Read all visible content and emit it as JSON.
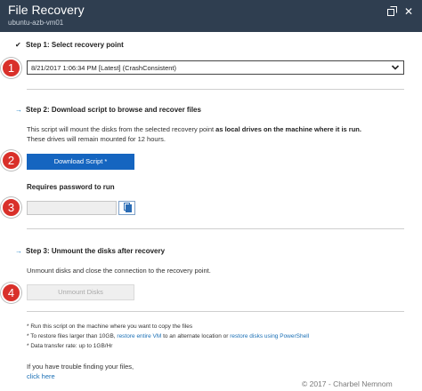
{
  "window": {
    "title": "File Recovery",
    "subtitle": "ubuntu-azb-vm01",
    "popout_icon": "popout-icon",
    "close_glyph": "✕"
  },
  "step1": {
    "mark": "✔",
    "heading": "Step 1: Select recovery point",
    "selected_point": "8/21/2017 1:06:34 PM [Latest] (CrashConsistent)"
  },
  "step2": {
    "mark": "→",
    "heading": "Step 2: Download script to browse and recover files",
    "desc_part1": "This script will mount the disks from the selected recovery point ",
    "desc_bold": "as local drives on the machine where it is run.",
    "desc_part2": "These drives will remain mounted for 12 hours.",
    "download_button": "Download Script *",
    "password_label": "Requires password to run",
    "password_value": ""
  },
  "step3": {
    "mark": "→",
    "heading": "Step 3: Unmount the disks after recovery",
    "desc": "Unmount disks and close the connection to the recovery point.",
    "unmount_button": "Unmount Disks"
  },
  "notes": {
    "line1": "* Run this script on the machine where you want to copy the files",
    "line2_a": "* To restore files larger than 10GB, ",
    "line2_link1": "restore entire VM",
    "line2_b": " to an alternate location or ",
    "line2_link2": "restore disks using PowerShell",
    "line3": "* Data transfer rate: up to 1GB/Hr"
  },
  "help": {
    "text": "If you have trouble finding your files,",
    "link": "click here"
  },
  "watermark": "© 2017 - Charbel Nemnom",
  "badges": [
    "1",
    "2",
    "3",
    "4"
  ],
  "colors": {
    "titlebar": "#2f3e50",
    "primary_button": "#1565c0",
    "link": "#1a6fb5",
    "badge": "#d9302a"
  }
}
